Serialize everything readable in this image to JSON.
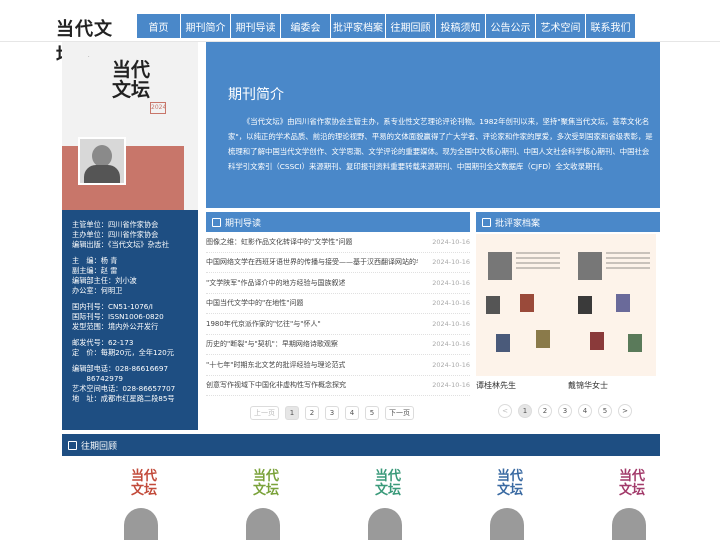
{
  "header": {
    "logo_text": "当代文坛",
    "nav": [
      {
        "label": "首页",
        "width": 44
      },
      {
        "label": "期刊简介",
        "width": 50
      },
      {
        "label": "期刊导读",
        "width": 50
      },
      {
        "label": "编委会",
        "width": 50
      },
      {
        "label": "批评家档案",
        "width": 55
      },
      {
        "label": "往期回顾",
        "width": 50
      },
      {
        "label": "投稿须知",
        "width": 50
      },
      {
        "label": "公告公示",
        "width": 50
      },
      {
        "label": "艺术空间",
        "width": 50
      },
      {
        "label": "联系我们",
        "width": 50
      }
    ]
  },
  "cover": {
    "title_line1": "当代",
    "title_line2": "文坛",
    "year": "2024"
  },
  "info": {
    "group1": [
      "主管单位：四川省作家协会",
      "主办单位：四川省作家协会",
      "编辑出版：《当代文坛》杂志社"
    ],
    "group2": [
      "主　编：杨 青",
      "副主编：赵 雷",
      "编辑部主任：刘小波",
      "办公室：何明卫"
    ],
    "group3": [
      "国内刊号：CN51-1076/I",
      "国际刊号：ISSN1006-0820",
      "发型范围：境内外公开发行"
    ],
    "group4": [
      "邮发代号：62-173",
      "定　价：每期20元，全年120元"
    ],
    "group5": [
      "编辑部电话：028-86616697",
      "　　86742979",
      "艺术空间电话：028-86657707",
      "地　址：成都市红星路二段85号"
    ]
  },
  "intro": {
    "title": "期刊简介",
    "text": "《当代文坛》由四川省作家协会主管主办，系专业性文艺理论评论刊物。1982年创刊以来，坚持\"聚焦当代文坛，荟萃文化名家\"，以纯正的学术品质、前沿的理论视野、平易的文体面貌赢得了广大学者、评论家和作家的厚爱，多次受到国家和省级表彰，是梳理和了解中国当代文学创作、文学思潮、文学评论的重要媒体。现为全国中文核心期刊、中国人文社会科学核心期刊、中国社会科学引文索引（CSSCI）来源期刊、复印报刊资料重要转载来源期刊、中国期刊全文数据库（CJFD）全文收录期刊。"
  },
  "guide": {
    "title": "期刊导读",
    "articles": [
      {
        "title": "图像之维：虹影作品文化转译中的\"文学性\"问题",
        "date": "2024-10-16"
      },
      {
        "title": "中国网络文学在西班牙语世界的传播与接受——基于汉西翻译网站的考察",
        "date": "2024-10-16"
      },
      {
        "title": "\"文学陕军\"作品译介中的地方经验与国族叙述",
        "date": "2024-10-16"
      },
      {
        "title": "中国当代文学中的\"在地性\"问题",
        "date": "2024-10-16"
      },
      {
        "title": "1980年代京派作家的\"忆往\"与\"怀人\"",
        "date": "2024-10-16"
      },
      {
        "title": "历史的\"断裂\"与\"契机\"：早期网络诗歌观察",
        "date": "2024-10-16"
      },
      {
        "title": "\"十七年\"时期东北文艺的批评经验与理论范式",
        "date": "2024-10-16"
      },
      {
        "title": "创意写作视域下中国化非虚构性写作概念探究",
        "date": "2024-10-16"
      }
    ],
    "pager": {
      "prev": "上一页",
      "next": "下一页",
      "pages": [
        "1",
        "2",
        "3",
        "4",
        "5"
      ]
    }
  },
  "critics": {
    "title": "批评家档案",
    "people": [
      {
        "name": "谭桂林先生"
      },
      {
        "name": "戴锦华女士"
      }
    ],
    "pager": {
      "prev": "<",
      "next": ">",
      "pages": [
        "1",
        "2",
        "3",
        "4",
        "5"
      ]
    }
  },
  "issues": {
    "title": "往期回顾",
    "items": [
      {
        "line1": "当代",
        "line2": "文坛",
        "color": "#c24a3a"
      },
      {
        "line1": "当代",
        "line2": "文坛",
        "color": "#7aa23a"
      },
      {
        "line1": "当代",
        "line2": "文坛",
        "color": "#3a9a7a"
      },
      {
        "line1": "当代",
        "line2": "文坛",
        "color": "#3a6aa2"
      },
      {
        "line1": "当代",
        "line2": "文坛",
        "color": "#a23a6a"
      }
    ]
  },
  "colors": {
    "accent": "#4a88c9",
    "dark": "#1e4e82",
    "cover_band": "#c8766a"
  }
}
